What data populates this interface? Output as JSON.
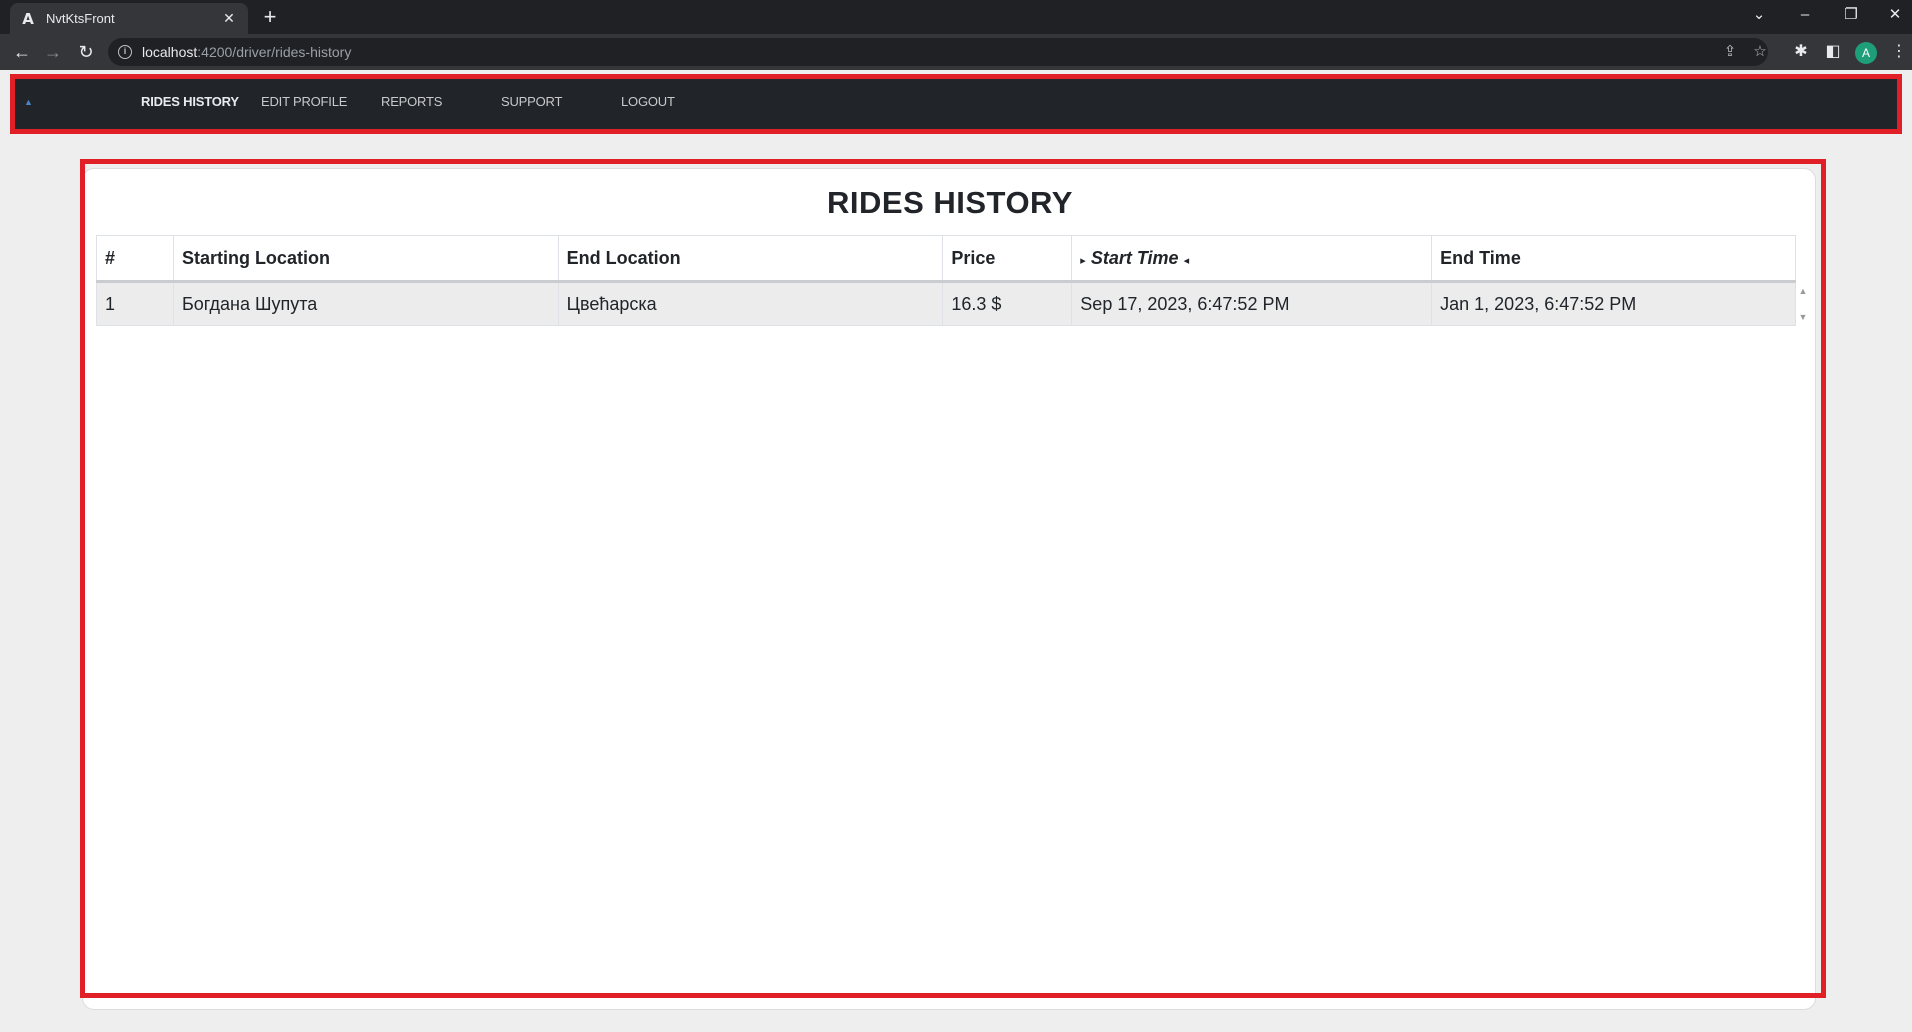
{
  "browser": {
    "tab_title": "NvtKtsFront",
    "tab_favicon": "A",
    "tab_close": "✕",
    "new_tab": "+",
    "url_host": "localhost",
    "url_path": ":4200/driver/rides-history",
    "profile_initial": "A",
    "icons": [
      "back-icon",
      "forward-icon",
      "reload-icon",
      "site-info-icon",
      "share-icon",
      "bookmark-star-icon",
      "extensions-icon",
      "side-panel-icon",
      "profile-avatar",
      "menu-icon"
    ]
  },
  "navbar": {
    "brand_icon": "car-icon",
    "links": [
      {
        "label": "RIDES HISTORY",
        "active": true
      },
      {
        "label": "EDIT PROFILE",
        "active": false
      },
      {
        "label": "REPORTS",
        "active": false
      },
      {
        "label": "SUPPORT",
        "active": false
      },
      {
        "label": "LOGOUT",
        "active": false
      }
    ]
  },
  "main": {
    "title": "RIDES HISTORY",
    "table": {
      "columns": [
        "#",
        "Starting Location",
        "End Location",
        "Price",
        "Start Time",
        "End Time"
      ],
      "sorted_column": "Start Time",
      "rows": [
        [
          "1",
          "Богдана Шупута",
          "Цвећарска",
          "16.3 $",
          "Sep 17, 2023, 6:47:52 PM",
          "Jan 1, 2023, 6:47:52 PM"
        ]
      ]
    }
  },
  "colors": {
    "highlight": "#e11f26",
    "navbar_bg": "#212529",
    "page_bg": "#eeeeee",
    "row_bg": "#ececec"
  }
}
